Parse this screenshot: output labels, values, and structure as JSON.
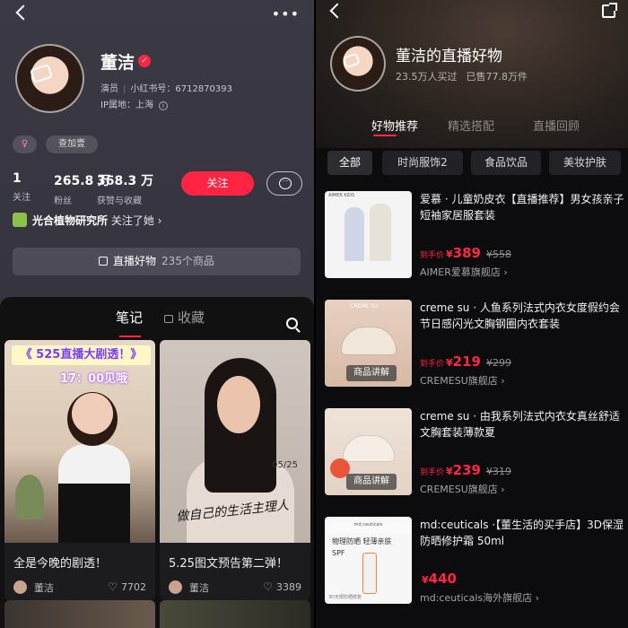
{
  "left": {
    "profile": {
      "name": "董洁",
      "verified_mark": "✓",
      "role": "演员",
      "redbook_id": "小红书号：6712870393",
      "ip": "IP属地：上海",
      "info_glyph": "i",
      "tags": [
        {
          "label": "♀"
        },
        {
          "label": "查加壹"
        }
      ],
      "stats": [
        {
          "num": "1",
          "label": "关注"
        },
        {
          "num": "265.8 万",
          "label": "粉丝"
        },
        {
          "num": "368.3 万",
          "label": "获赞与收藏"
        }
      ],
      "follow_label": "关注",
      "message_icon": "chat-bubble-icon",
      "mutual_name": "光合植物研究所",
      "mutual_text": "关注了她 ›",
      "live_label": "直播好物",
      "live_count": "235个商品"
    },
    "tabs": [
      {
        "label": "笔记"
      },
      {
        "label": "收藏"
      }
    ],
    "notes": [
      {
        "title": "全是今晚的剧透！",
        "author": "董洁",
        "likes": "7702",
        "banner": "《 525直播大剧透！》",
        "time": "17：00见哦"
      },
      {
        "title": "5.25图文预告第二弹！",
        "author": "董洁",
        "likes": "3389",
        "script": "做自己的生活主理人",
        "date": "05/25"
      }
    ]
  },
  "right": {
    "shop_title": "董洁的直播好物",
    "buyers": "23.5万人买过",
    "sold": "已售77.8万件",
    "tabs": [
      {
        "label": "好物推荐"
      },
      {
        "label": "精选搭配"
      },
      {
        "label": "直播回顾"
      }
    ],
    "chips": [
      {
        "label": "全部"
      },
      {
        "label": "时尚服饰2"
      },
      {
        "label": "食品饮品"
      },
      {
        "label": "美妆护肤"
      }
    ],
    "products": [
      {
        "name": "爱慕 · 儿童奶皮衣【直播推荐】男女孩亲子短袖家居服套装",
        "price_prefix": "到手价",
        "currency": "¥",
        "price": "389",
        "old_price": "¥558",
        "shop": "AIMER爱慕旗舰店 ›",
        "image_brand": "AIMER KIDS"
      },
      {
        "name": "creme su · 人鱼系列法式内衣女度假约会节日感闪光文胸钢圈内衣套装",
        "price_prefix": "到手价",
        "currency": "¥",
        "price": "219",
        "old_price": "¥299",
        "shop": "CREMESU旗舰店 ›",
        "image_brand": "CREME SU",
        "badge": "商品讲解"
      },
      {
        "name": "creme su · 由我系列法式内衣女真丝舒适文胸套装薄款夏",
        "price_prefix": "到手价",
        "currency": "¥",
        "price": "239",
        "old_price": "¥319",
        "shop": "CREMESU旗舰店 ›",
        "badge": "商品讲解"
      },
      {
        "name": "md:ceuticals ·【董生活的买手店】3D保湿防晒修护霜 50ml",
        "price_prefix": "",
        "currency": "¥",
        "price": "440",
        "old_price": "",
        "shop": "md:ceuticals海外旗舰店 ›",
        "image_brand": "md:ceuticals",
        "image_line1": "物理防晒 轻薄亲肤",
        "image_line2": "SPF",
        "image_foot": "3D无限防晒修复"
      }
    ]
  },
  "colors": {
    "accent": "#ff2442"
  }
}
